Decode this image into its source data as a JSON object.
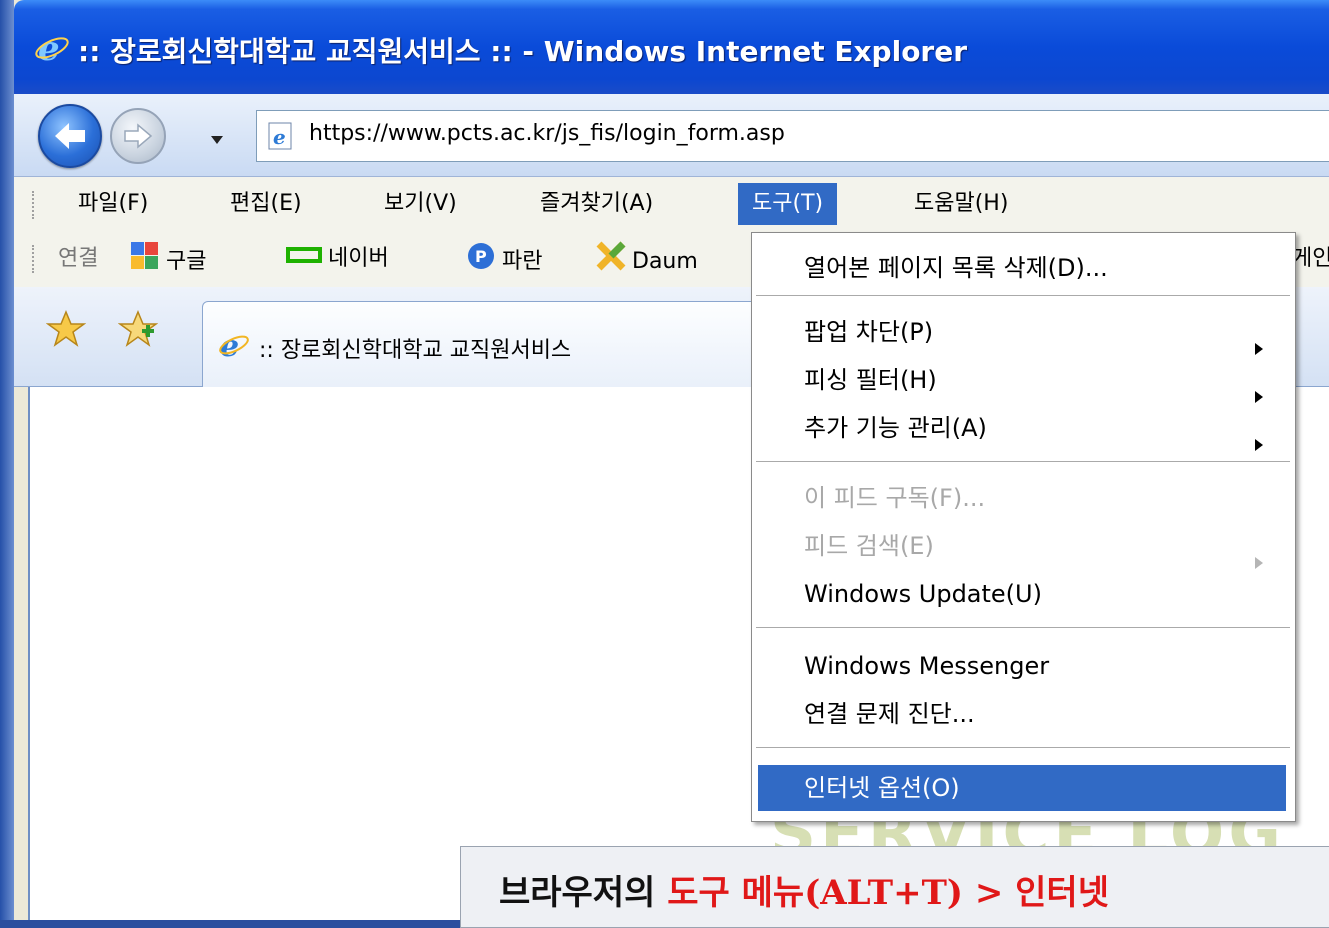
{
  "window": {
    "title": ":: 장로회신학대학교 교직원서비스 :: - Windows Internet Explorer"
  },
  "address_bar": {
    "url": "https://www.pcts.ac.kr/js_fis/login_form.asp"
  },
  "menubar": {
    "items": [
      "파일(F)",
      "편집(E)",
      "보기(V)",
      "즐겨찾기(A)",
      "도구(T)",
      "도움말(H)"
    ],
    "active": "도구(T)"
  },
  "links_bar": {
    "label": "연결",
    "items": [
      "구글",
      "네이버",
      "파란",
      "Daum"
    ],
    "overflow_text": "게인"
  },
  "tab": {
    "title": ":: 장로회신학대학교 교직원서비스"
  },
  "tools_menu": {
    "items": [
      {
        "label": "열어본 페이지 목록 삭제(D)...",
        "disabled": false,
        "submenu": false,
        "selected": false
      },
      {
        "label": "팝업 차단(P)",
        "disabled": false,
        "submenu": true,
        "selected": false
      },
      {
        "label": "피싱 필터(H)",
        "disabled": false,
        "submenu": true,
        "selected": false
      },
      {
        "label": "추가 기능 관리(A)",
        "disabled": false,
        "submenu": true,
        "selected": false
      },
      {
        "label": "이 피드 구독(F)...",
        "disabled": true,
        "submenu": false,
        "selected": false
      },
      {
        "label": "피드 검색(E)",
        "disabled": true,
        "submenu": true,
        "selected": false
      },
      {
        "label": "Windows Update(U)",
        "disabled": false,
        "submenu": false,
        "selected": false
      },
      {
        "label": "Windows Messenger",
        "disabled": false,
        "submenu": false,
        "selected": false
      },
      {
        "label": "연결 문제 진단...",
        "disabled": false,
        "submenu": false,
        "selected": false
      },
      {
        "label": "인터넷 옵션(O)",
        "disabled": false,
        "submenu": false,
        "selected": true
      }
    ]
  },
  "background_text": "SERVICE LOG",
  "caption": {
    "prefix": "브라우저의 ",
    "highlight": "도구 메뉴(ALT+T) > 인터넷",
    "highlight_color": "#e01818"
  },
  "colors": {
    "title_bar": "#0a4bd9",
    "menu_highlight": "#316ac5"
  }
}
